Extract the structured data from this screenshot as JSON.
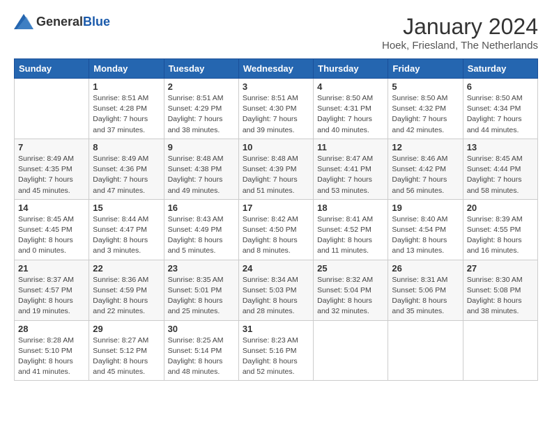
{
  "logo": {
    "text_general": "General",
    "text_blue": "Blue"
  },
  "header": {
    "month_title": "January 2024",
    "location": "Hoek, Friesland, The Netherlands"
  },
  "days_of_week": [
    "Sunday",
    "Monday",
    "Tuesday",
    "Wednesday",
    "Thursday",
    "Friday",
    "Saturday"
  ],
  "weeks": [
    [
      {
        "day": "",
        "detail": ""
      },
      {
        "day": "1",
        "detail": "Sunrise: 8:51 AM\nSunset: 4:28 PM\nDaylight: 7 hours\nand 37 minutes."
      },
      {
        "day": "2",
        "detail": "Sunrise: 8:51 AM\nSunset: 4:29 PM\nDaylight: 7 hours\nand 38 minutes."
      },
      {
        "day": "3",
        "detail": "Sunrise: 8:51 AM\nSunset: 4:30 PM\nDaylight: 7 hours\nand 39 minutes."
      },
      {
        "day": "4",
        "detail": "Sunrise: 8:50 AM\nSunset: 4:31 PM\nDaylight: 7 hours\nand 40 minutes."
      },
      {
        "day": "5",
        "detail": "Sunrise: 8:50 AM\nSunset: 4:32 PM\nDaylight: 7 hours\nand 42 minutes."
      },
      {
        "day": "6",
        "detail": "Sunrise: 8:50 AM\nSunset: 4:34 PM\nDaylight: 7 hours\nand 44 minutes."
      }
    ],
    [
      {
        "day": "7",
        "detail": "Sunrise: 8:49 AM\nSunset: 4:35 PM\nDaylight: 7 hours\nand 45 minutes."
      },
      {
        "day": "8",
        "detail": "Sunrise: 8:49 AM\nSunset: 4:36 PM\nDaylight: 7 hours\nand 47 minutes."
      },
      {
        "day": "9",
        "detail": "Sunrise: 8:48 AM\nSunset: 4:38 PM\nDaylight: 7 hours\nand 49 minutes."
      },
      {
        "day": "10",
        "detail": "Sunrise: 8:48 AM\nSunset: 4:39 PM\nDaylight: 7 hours\nand 51 minutes."
      },
      {
        "day": "11",
        "detail": "Sunrise: 8:47 AM\nSunset: 4:41 PM\nDaylight: 7 hours\nand 53 minutes."
      },
      {
        "day": "12",
        "detail": "Sunrise: 8:46 AM\nSunset: 4:42 PM\nDaylight: 7 hours\nand 56 minutes."
      },
      {
        "day": "13",
        "detail": "Sunrise: 8:45 AM\nSunset: 4:44 PM\nDaylight: 7 hours\nand 58 minutes."
      }
    ],
    [
      {
        "day": "14",
        "detail": "Sunrise: 8:45 AM\nSunset: 4:45 PM\nDaylight: 8 hours\nand 0 minutes."
      },
      {
        "day": "15",
        "detail": "Sunrise: 8:44 AM\nSunset: 4:47 PM\nDaylight: 8 hours\nand 3 minutes."
      },
      {
        "day": "16",
        "detail": "Sunrise: 8:43 AM\nSunset: 4:49 PM\nDaylight: 8 hours\nand 5 minutes."
      },
      {
        "day": "17",
        "detail": "Sunrise: 8:42 AM\nSunset: 4:50 PM\nDaylight: 8 hours\nand 8 minutes."
      },
      {
        "day": "18",
        "detail": "Sunrise: 8:41 AM\nSunset: 4:52 PM\nDaylight: 8 hours\nand 11 minutes."
      },
      {
        "day": "19",
        "detail": "Sunrise: 8:40 AM\nSunset: 4:54 PM\nDaylight: 8 hours\nand 13 minutes."
      },
      {
        "day": "20",
        "detail": "Sunrise: 8:39 AM\nSunset: 4:55 PM\nDaylight: 8 hours\nand 16 minutes."
      }
    ],
    [
      {
        "day": "21",
        "detail": "Sunrise: 8:37 AM\nSunset: 4:57 PM\nDaylight: 8 hours\nand 19 minutes."
      },
      {
        "day": "22",
        "detail": "Sunrise: 8:36 AM\nSunset: 4:59 PM\nDaylight: 8 hours\nand 22 minutes."
      },
      {
        "day": "23",
        "detail": "Sunrise: 8:35 AM\nSunset: 5:01 PM\nDaylight: 8 hours\nand 25 minutes."
      },
      {
        "day": "24",
        "detail": "Sunrise: 8:34 AM\nSunset: 5:03 PM\nDaylight: 8 hours\nand 28 minutes."
      },
      {
        "day": "25",
        "detail": "Sunrise: 8:32 AM\nSunset: 5:04 PM\nDaylight: 8 hours\nand 32 minutes."
      },
      {
        "day": "26",
        "detail": "Sunrise: 8:31 AM\nSunset: 5:06 PM\nDaylight: 8 hours\nand 35 minutes."
      },
      {
        "day": "27",
        "detail": "Sunrise: 8:30 AM\nSunset: 5:08 PM\nDaylight: 8 hours\nand 38 minutes."
      }
    ],
    [
      {
        "day": "28",
        "detail": "Sunrise: 8:28 AM\nSunset: 5:10 PM\nDaylight: 8 hours\nand 41 minutes."
      },
      {
        "day": "29",
        "detail": "Sunrise: 8:27 AM\nSunset: 5:12 PM\nDaylight: 8 hours\nand 45 minutes."
      },
      {
        "day": "30",
        "detail": "Sunrise: 8:25 AM\nSunset: 5:14 PM\nDaylight: 8 hours\nand 48 minutes."
      },
      {
        "day": "31",
        "detail": "Sunrise: 8:23 AM\nSunset: 5:16 PM\nDaylight: 8 hours\nand 52 minutes."
      },
      {
        "day": "",
        "detail": ""
      },
      {
        "day": "",
        "detail": ""
      },
      {
        "day": "",
        "detail": ""
      }
    ]
  ]
}
